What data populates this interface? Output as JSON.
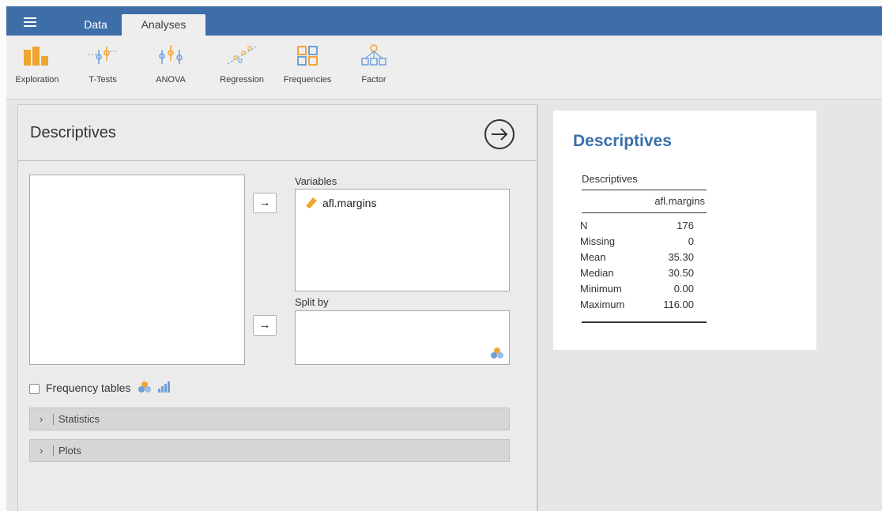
{
  "tabs": {
    "data": "Data",
    "analyses": "Analyses"
  },
  "ribbon": [
    {
      "label": "Exploration",
      "icon": "exploration-icon"
    },
    {
      "label": "T-Tests",
      "icon": "t-tests-icon"
    },
    {
      "label": "ANOVA",
      "icon": "anova-icon"
    },
    {
      "label": "Regression",
      "icon": "regression-icon"
    },
    {
      "label": "Frequencies",
      "icon": "frequencies-icon"
    },
    {
      "label": "Factor",
      "icon": "factor-icon"
    }
  ],
  "options": {
    "title": "Descriptives",
    "variables_label": "Variables",
    "variables": [
      "afl.margins"
    ],
    "split_by_label": "Split by",
    "frequency_tables_label": "Frequency tables",
    "frequency_tables_checked": false,
    "arrow": "→",
    "sections": [
      "Statistics",
      "Plots"
    ]
  },
  "results": {
    "title": "Descriptives",
    "table_title": "Descriptives",
    "column": "afl.margins",
    "rows": [
      {
        "label": "N",
        "value": "176"
      },
      {
        "label": "Missing",
        "value": "0"
      },
      {
        "label": "Mean",
        "value": "35.30"
      },
      {
        "label": "Median",
        "value": "30.50"
      },
      {
        "label": "Minimum",
        "value": "0.00"
      },
      {
        "label": "Maximum",
        "value": "116.00"
      }
    ]
  },
  "colors": {
    "topbar": "#3e6ea8",
    "accent_orange": "#f0a531",
    "results_title": "#3a6fa8"
  }
}
